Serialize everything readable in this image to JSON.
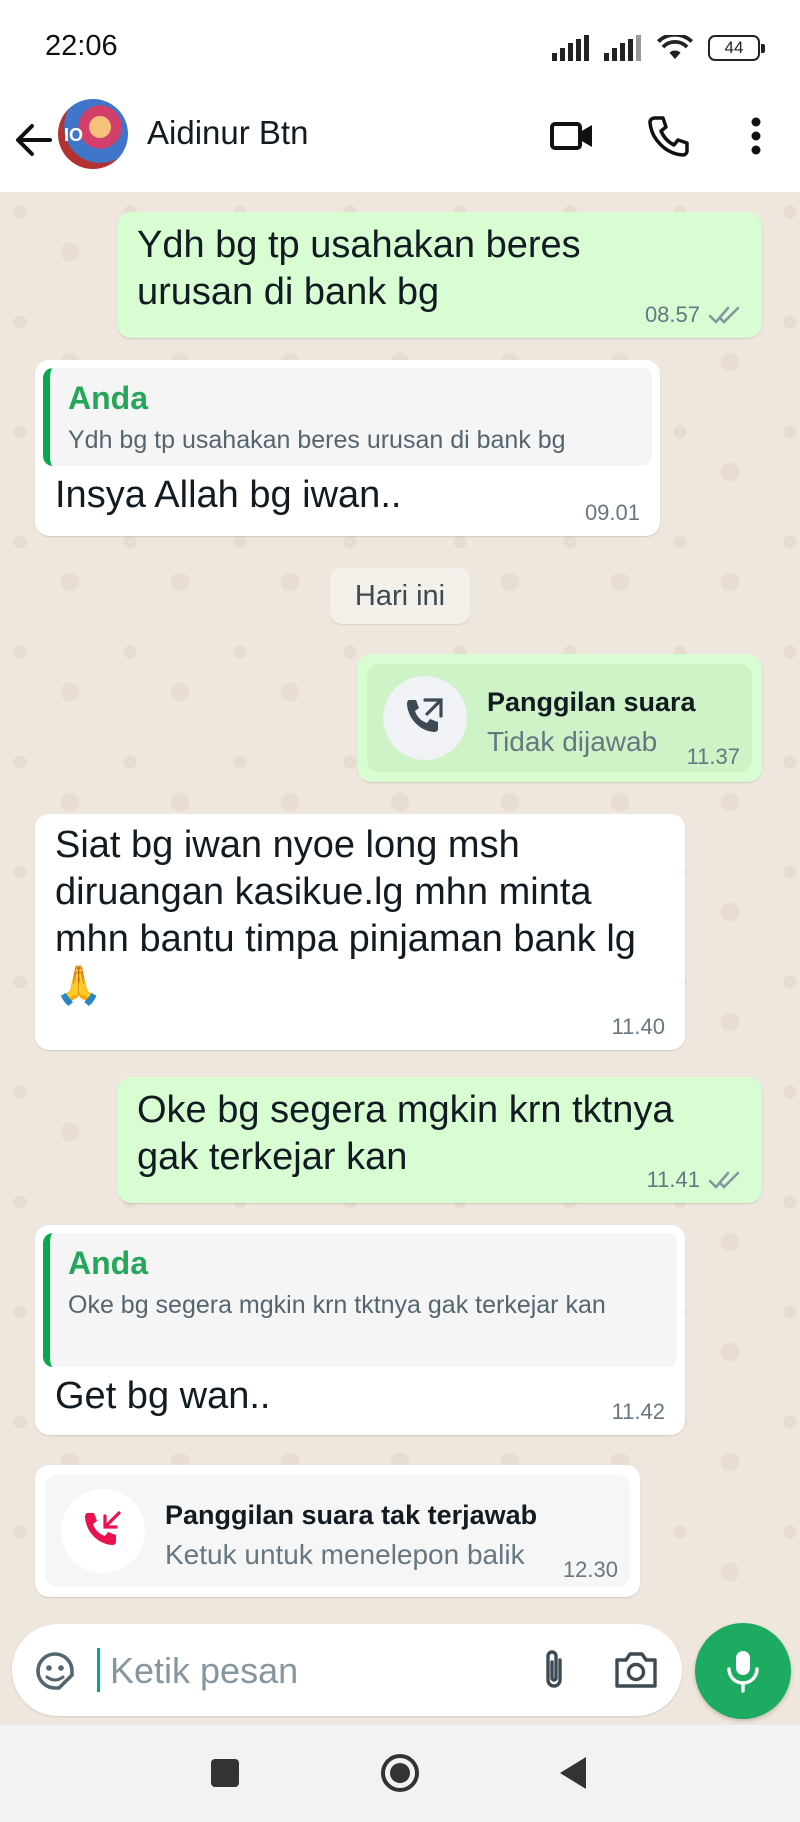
{
  "status_bar": {
    "time": "22:06",
    "battery": "44"
  },
  "header": {
    "contact_name": "Aidinur Btn",
    "avatar_text": "IO"
  },
  "messages": [
    {
      "text": "Ydh bg tp usahakan beres urusan di bank bg",
      "time": "08.57"
    },
    {
      "quote_author": "Anda",
      "quote_text": "Ydh bg tp usahakan beres urusan di bank bg",
      "text": "Insya Allah bg iwan..",
      "time": "09.01"
    },
    {
      "date_chip": "Hari ini"
    },
    {
      "call_title": "Panggilan suara",
      "call_sub": "Tidak dijawab",
      "time": "11.37"
    },
    {
      "text": "Siat bg iwan nyoe long msh diruangan kasikue.lg mhn minta mhn bantu timpa pinjaman bank lg 🙏",
      "time": "11.40"
    },
    {
      "text": "Oke bg segera mgkin krn tktnya gak terkejar kan",
      "time": "11.41"
    },
    {
      "quote_author": "Anda",
      "quote_text": "Oke bg segera mgkin krn tktnya gak terkejar kan",
      "text": "Get bg wan..",
      "time": "11.42"
    },
    {
      "call_title": "Panggilan suara tak terjawab",
      "call_sub": "Ketuk untuk menelepon balik",
      "time": "12.30"
    }
  ],
  "input": {
    "placeholder": "Ketik pesan"
  },
  "colors": {
    "outgoing_bubble": "#d9fdd3",
    "incoming_bubble": "#ffffff",
    "accent_green": "#1daa61",
    "quote_author": "#26a65a",
    "missed_call_red": "#e9124f"
  },
  "icons": {
    "back": "arrow-left-icon",
    "video": "video-camera-icon",
    "call": "phone-icon",
    "menu": "more-vertical-icon",
    "sticker": "sticker-icon",
    "attach": "paperclip-icon",
    "camera": "camera-icon",
    "mic": "microphone-icon"
  }
}
